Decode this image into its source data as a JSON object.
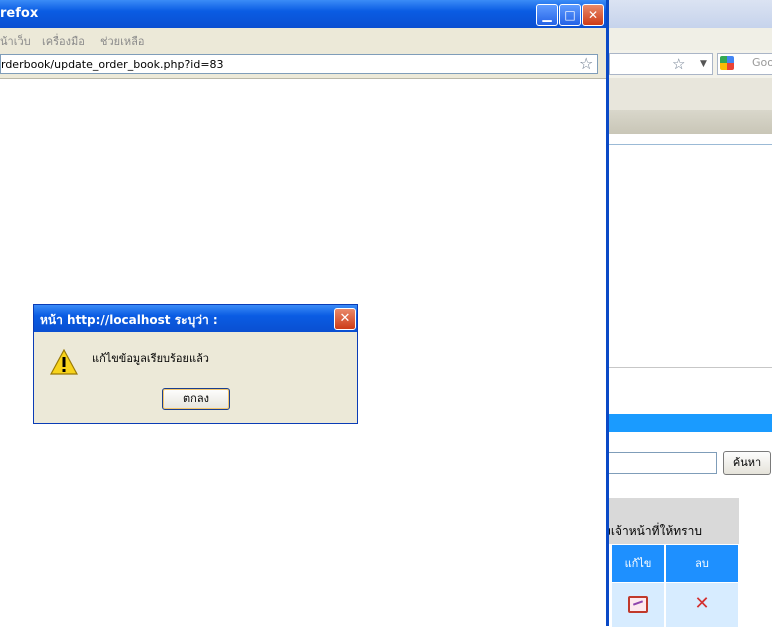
{
  "main_window": {
    "title": "refox",
    "menu": [
      "น้าเว็บ",
      "เครื่องมือ",
      "ช่วยเหลือ"
    ],
    "url": "rderbook/update_order_book.php?id=83"
  },
  "dialog": {
    "title": "หน้า http://localhost ระบุว่า :",
    "message": "แก้ไขข้อมูลเรียบร้อยแล้ว",
    "ok_label": "ตกลง",
    "close_glyph": "✕"
  },
  "background_window": {
    "search_engine_text": "Goo",
    "search_button_label": "ค้นหา",
    "table_header_text": "ังเจ้าหน้าที่ให้ทราบ",
    "columns": [
      "แก้ไข",
      "ลบ"
    ],
    "row_delete_glyph": "✕"
  },
  "icons": {
    "warning": "warning-icon",
    "edit": "edit-icon",
    "delete": "delete-icon",
    "star": "bookmark-star-icon"
  },
  "colors": {
    "titlebar_blue": "#0a5ce3",
    "dialog_face": "#ece9d8",
    "table_header_blue": "#1e90ff",
    "accent_bar": "#1a9bff"
  }
}
